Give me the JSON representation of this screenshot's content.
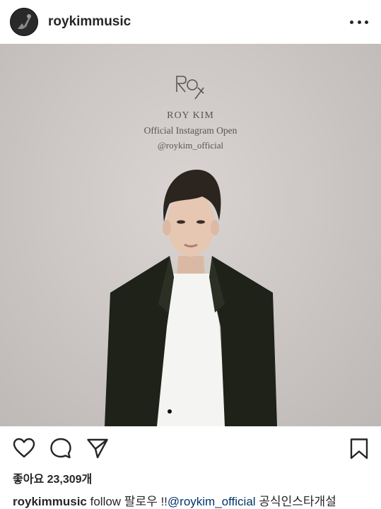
{
  "post": {
    "username": "roykimmusic",
    "photo": {
      "logo_text": "ROY",
      "title": "ROY KIM",
      "subtitle": "Official Instagram Open",
      "handle": "@roykim_official"
    },
    "likes_label": "좋아요 23,309개",
    "caption": {
      "user": "roykimmusic",
      "text_before": "follow 팔로우 !!",
      "mention": "@roykim_official",
      "text_after": "공식인스타개설"
    }
  },
  "icons": {
    "more": "more-options-icon",
    "like": "heart-icon",
    "comment": "comment-icon",
    "share": "send-icon",
    "save": "bookmark-icon"
  },
  "colors": {
    "text": "#262626",
    "mention": "#003569",
    "photo_background": "#cdc8c6",
    "jacket": "#1f2219"
  }
}
